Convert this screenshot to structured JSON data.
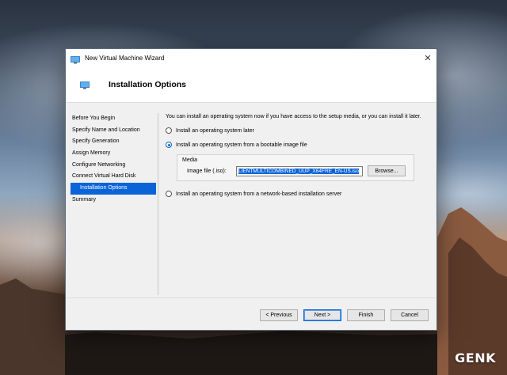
{
  "window": {
    "title": "New Virtual Machine Wizard",
    "close_glyph": "✕"
  },
  "header": {
    "title": "Installation Options"
  },
  "nav": {
    "items": [
      {
        "label": "Before You Begin"
      },
      {
        "label": "Specify Name and Location"
      },
      {
        "label": "Specify Generation"
      },
      {
        "label": "Assign Memory"
      },
      {
        "label": "Configure Networking"
      },
      {
        "label": "Connect Virtual Hard Disk"
      },
      {
        "label": "Installation Options"
      },
      {
        "label": "Summary"
      }
    ]
  },
  "content": {
    "intro": "You can install an operating system now if you have access to the setup media, or you can install it later.",
    "options": [
      {
        "label": "Install an operating system later",
        "checked": false
      },
      {
        "label": "Install an operating system from a bootable image file",
        "checked": true
      },
      {
        "label": "Install an operating system from a network-based installation server",
        "checked": false
      }
    ],
    "media": {
      "group_label": "Media",
      "file_label": "Image file (.iso):",
      "file_value": "LIENTMULTICOMBINED_UUP_X64FRE_EN-US.iso",
      "browse_label": "Browse..."
    }
  },
  "footer": {
    "previous": "< Previous",
    "next": "Next >",
    "finish": "Finish",
    "cancel": "Cancel"
  },
  "watermark": "GENK",
  "colors": {
    "accent": "#0a64d8"
  }
}
